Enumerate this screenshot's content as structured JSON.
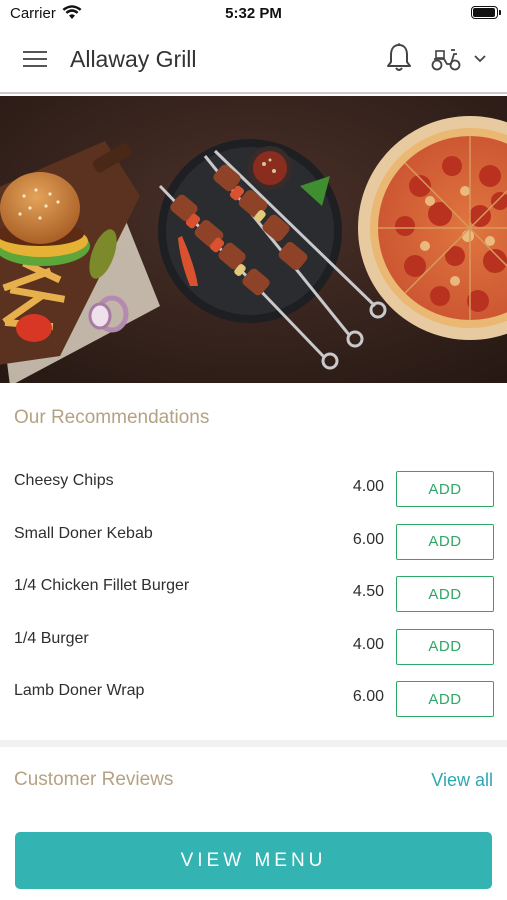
{
  "status_bar": {
    "carrier": "Carrier",
    "time": "5:32 PM",
    "icons": [
      "wifi-icon",
      "battery-icon"
    ]
  },
  "header": {
    "title": "Allaway Grill",
    "icons": [
      "hamburger-menu-icon",
      "bell-icon",
      "delivery-scooter-icon",
      "chevron-down-icon"
    ]
  },
  "hero": {
    "description_icons": [
      "burger",
      "kebab-skewers",
      "pizza"
    ]
  },
  "recommendations": {
    "title": "Our Recommendations",
    "add_label": "ADD",
    "items": [
      {
        "name": "Cheesy Chips",
        "price": "4.00"
      },
      {
        "name": "Small Doner Kebab",
        "price": "6.00"
      },
      {
        "name": "1/4 Chicken Fillet Burger",
        "price": "4.50"
      },
      {
        "name": "1/4 Burger",
        "price": "4.00"
      },
      {
        "name": "Lamb Doner Wrap",
        "price": "6.00"
      }
    ]
  },
  "reviews": {
    "title": "Customer Reviews",
    "view_all": "View all"
  },
  "cta": {
    "label": "VIEW MENU"
  },
  "colors": {
    "accent_teal": "#33b3b2",
    "link_teal": "#2da7b1",
    "add_green": "#2fa766",
    "section_heading": "#b4a284"
  }
}
